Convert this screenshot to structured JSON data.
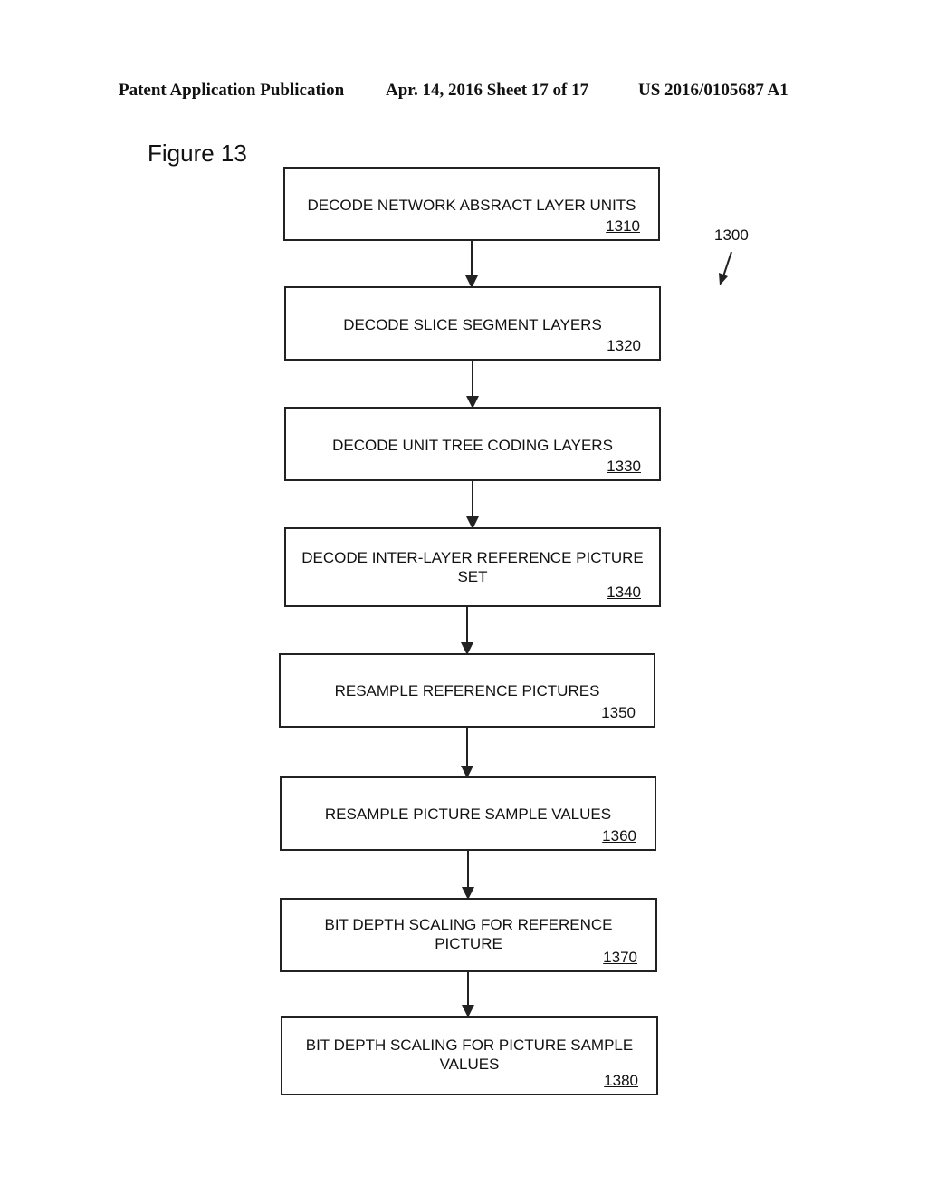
{
  "header": {
    "left": "Patent Application Publication",
    "middle": "Apr. 14, 2016  Sheet 17 of 17",
    "right": "US 2016/0105687 A1"
  },
  "figure": {
    "title": "Figure 13",
    "reference": "1300",
    "steps": [
      {
        "label": "DECODE NETWORK ABSRACT LAYER UNITS",
        "number": "1310"
      },
      {
        "label": "DECODE SLICE SEGMENT LAYERS",
        "number": "1320"
      },
      {
        "label": "DECODE UNIT TREE CODING LAYERS",
        "number": "1330"
      },
      {
        "label": "DECODE INTER-LAYER REFERENCE PICTURE SET",
        "number": "1340"
      },
      {
        "label": "RESAMPLE REFERENCE PICTURES",
        "number": "1350"
      },
      {
        "label": "RESAMPLE PICTURE SAMPLE VALUES",
        "number": "1360"
      },
      {
        "label": "BIT DEPTH SCALING FOR REFERENCE PICTURE",
        "number": "1370"
      },
      {
        "label": "BIT DEPTH SCALING FOR PICTURE SAMPLE VALUES",
        "number": "1380"
      }
    ]
  }
}
